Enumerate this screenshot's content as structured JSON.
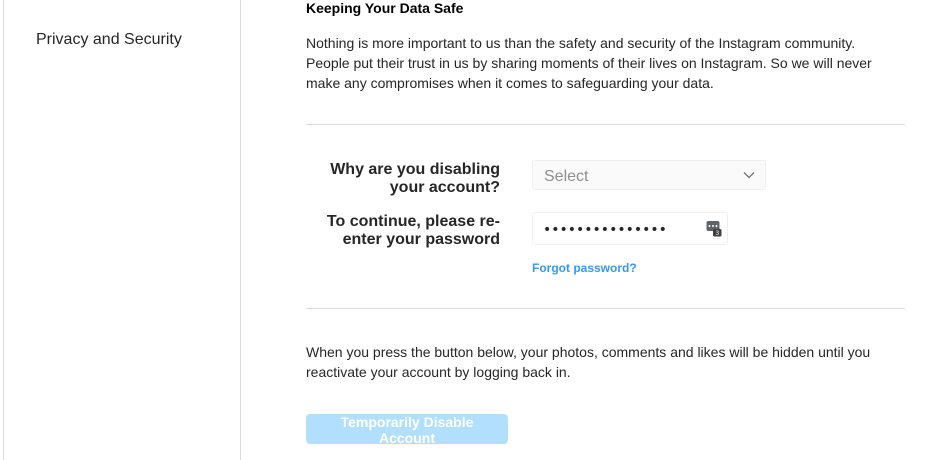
{
  "sidebar": {
    "items": [
      {
        "label": "Privacy and Security"
      }
    ]
  },
  "main": {
    "heading": "Keeping Your Data Safe",
    "intro_lines": [
      "Nothing is more important to us than the safety and security of the Instagram community.",
      "People put their trust in us by sharing moments of their lives on Instagram. So we will never",
      "make any compromises when it comes to safeguarding your data."
    ],
    "form": {
      "reason_label_line1": "Why are you disabling",
      "reason_label_line2": "your account?",
      "reason_select_value": "Select",
      "password_label_line1": "To continue, please re-",
      "password_label_line2": "enter your password",
      "password_value": "•••••••••••••••",
      "forgot_password": "Forgot password?"
    },
    "outro_lines": [
      "When you press the button below, your photos, comments and likes will be hidden until you",
      "reactivate your account by logging back in."
    ],
    "disable_button": "Temporarily Disable Account"
  },
  "icons": {
    "select_chevron": "chevron-down-icon",
    "password_manager": "password-manager-key-icon"
  },
  "colors": {
    "link": "#3897f0",
    "button_disabled": "#b2dffc",
    "divider": "#dbdbdb"
  }
}
